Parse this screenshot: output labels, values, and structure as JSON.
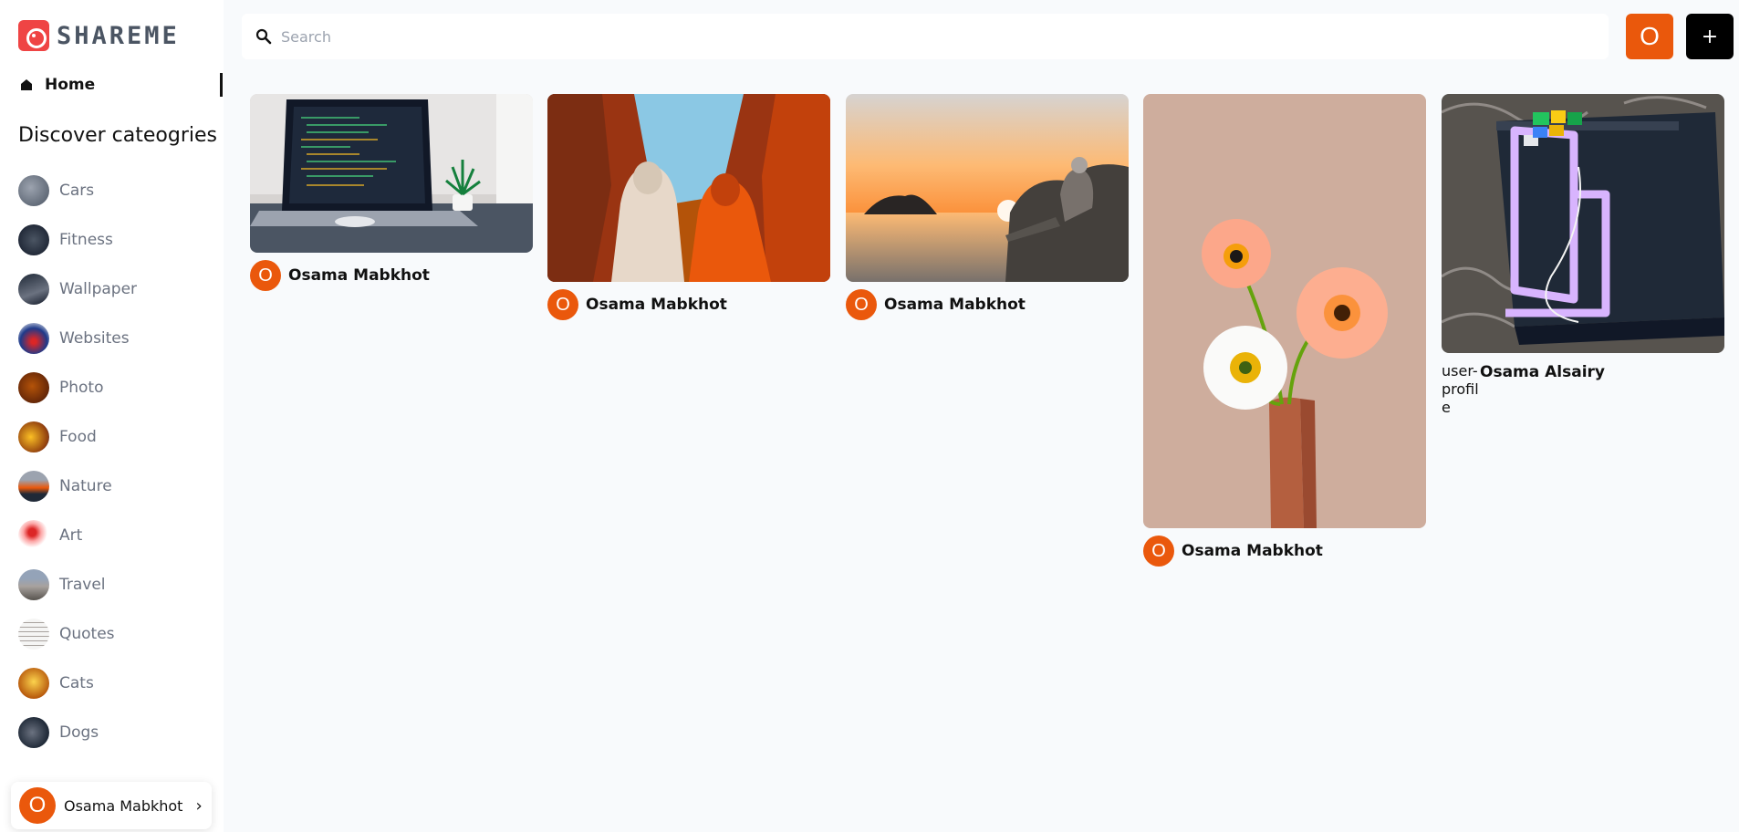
{
  "app": {
    "logo_text": "SHAREME",
    "brand_color": "#ef4444",
    "accent_color": "#ea580c"
  },
  "sidebar": {
    "home_label": "Home",
    "discover_title": "Discover cateogries",
    "categories": [
      {
        "label": "Cars",
        "color": "#6b7280"
      },
      {
        "label": "Fitness",
        "color": "#1f2937"
      },
      {
        "label": "Wallpaper",
        "color": "#374151"
      },
      {
        "label": "Websites",
        "color": "#1e3a8a"
      },
      {
        "label": "Photo",
        "color": "#7c2d12"
      },
      {
        "label": "Food",
        "color": "#b45309"
      },
      {
        "label": "Nature",
        "color": "#9a3412"
      },
      {
        "label": "Art",
        "color": "#dc2626"
      },
      {
        "label": "Travel",
        "color": "#78716c"
      },
      {
        "label": "Quotes",
        "color": "#e7e5e4"
      },
      {
        "label": "Cats",
        "color": "#d97706"
      },
      {
        "label": "Dogs",
        "color": "#4b5563"
      }
    ],
    "user": {
      "initial": "O",
      "name": "Osama Mabkhot"
    }
  },
  "topbar": {
    "search_placeholder": "Search",
    "user_initial": "O",
    "add_label": "+"
  },
  "pins": [
    {
      "image": "laptop on desk",
      "author_initial": "O",
      "author": "Osama Mabkhot"
    },
    {
      "image": "two women in canyon",
      "author_initial": "O",
      "author": "Osama Mabkhot"
    },
    {
      "image": "sunset by the sea",
      "author_initial": "O",
      "author": "Osama Mabkhot"
    },
    {
      "image": "poppies in vase",
      "author_initial": "O",
      "author": "Osama Mabkhot"
    },
    {
      "image": "electronics board",
      "author_alt": "user-profile",
      "author": "Osama Alsairy"
    }
  ]
}
